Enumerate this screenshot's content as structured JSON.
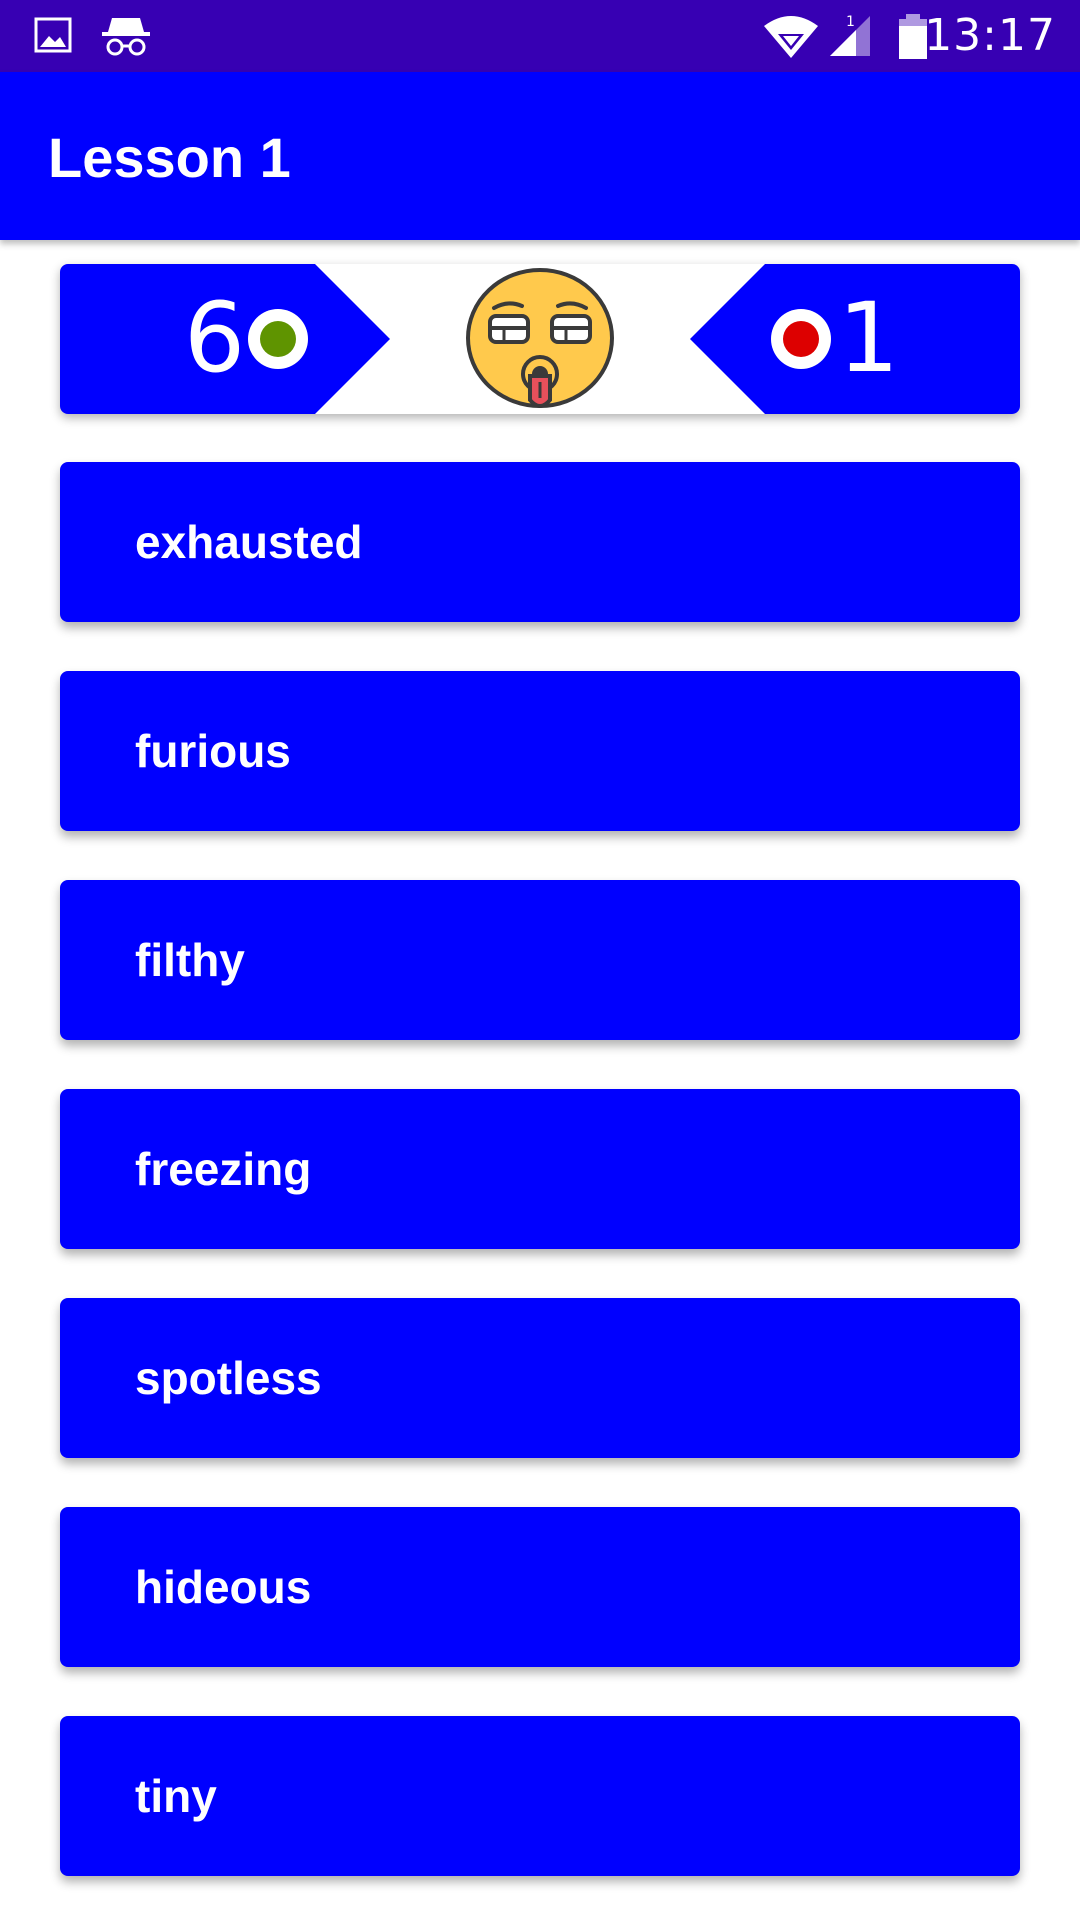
{
  "status_bar": {
    "time": "13:17",
    "left_icons": [
      "image-icon",
      "incognito-icon"
    ],
    "right_icons": [
      "wifi-icon",
      "signal-icon",
      "battery-icon"
    ],
    "signal_sim_label": "1",
    "color": "#3700b3"
  },
  "app_bar": {
    "title": "Lesson 1",
    "color": "#0000ff"
  },
  "score": {
    "correct": "6",
    "wrong": "1",
    "correct_color": "#5f9400",
    "wrong_color": "#dd0000",
    "face_icon": "exhausted-face-icon"
  },
  "options": [
    {
      "label": "exhausted"
    },
    {
      "label": "furious"
    },
    {
      "label": "filthy"
    },
    {
      "label": "freezing"
    },
    {
      "label": "spotless"
    },
    {
      "label": "hideous"
    },
    {
      "label": "tiny"
    }
  ],
  "colors": {
    "primary": "#0000ff",
    "on_primary": "#ffffff"
  }
}
